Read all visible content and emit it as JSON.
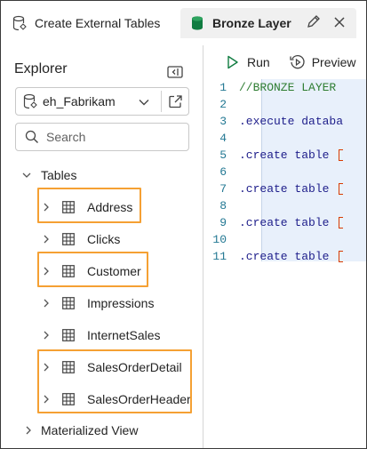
{
  "tabs": [
    {
      "label": "Create External Tables",
      "active": false
    },
    {
      "label": "Bronze Layer",
      "active": true
    }
  ],
  "explorer": {
    "title": "Explorer",
    "database": "eh_Fabrikam",
    "search_placeholder": "Search",
    "tables_label": "Tables",
    "tables": [
      {
        "label": "Address",
        "highlighted": true
      },
      {
        "label": "Clicks",
        "highlighted": false
      },
      {
        "label": "Customer",
        "highlighted": true
      },
      {
        "label": "Impressions",
        "highlighted": false
      },
      {
        "label": "InternetSales",
        "highlighted": false
      },
      {
        "label": "SalesOrderDetail",
        "highlighted": true
      },
      {
        "label": "SalesOrderHeader",
        "highlighted": true
      }
    ],
    "materialized_label": "Materialized View"
  },
  "toolbar": {
    "run_label": "Run",
    "preview_label": "Preview"
  },
  "editor": {
    "lines": [
      {
        "n": "1",
        "text": "//BRONZE LAYER",
        "kind": "comment"
      },
      {
        "n": "2",
        "text": "",
        "kind": "blank"
      },
      {
        "n": "3",
        "text": ".execute databa",
        "kind": "code"
      },
      {
        "n": "4",
        "text": "",
        "kind": "blank"
      },
      {
        "n": "5",
        "text": ".create table ",
        "kind": "code-bracket"
      },
      {
        "n": "6",
        "text": "",
        "kind": "blank"
      },
      {
        "n": "7",
        "text": ".create table ",
        "kind": "code-bracket"
      },
      {
        "n": "8",
        "text": "",
        "kind": "blank"
      },
      {
        "n": "9",
        "text": ".create table ",
        "kind": "code-bracket"
      },
      {
        "n": "10",
        "text": "",
        "kind": "blank"
      },
      {
        "n": "11",
        "text": ".create table ",
        "kind": "code-bracket"
      }
    ]
  },
  "colors": {
    "highlight_border": "#f5a033",
    "accent_green": "#107c41",
    "line_number": "#237893"
  }
}
